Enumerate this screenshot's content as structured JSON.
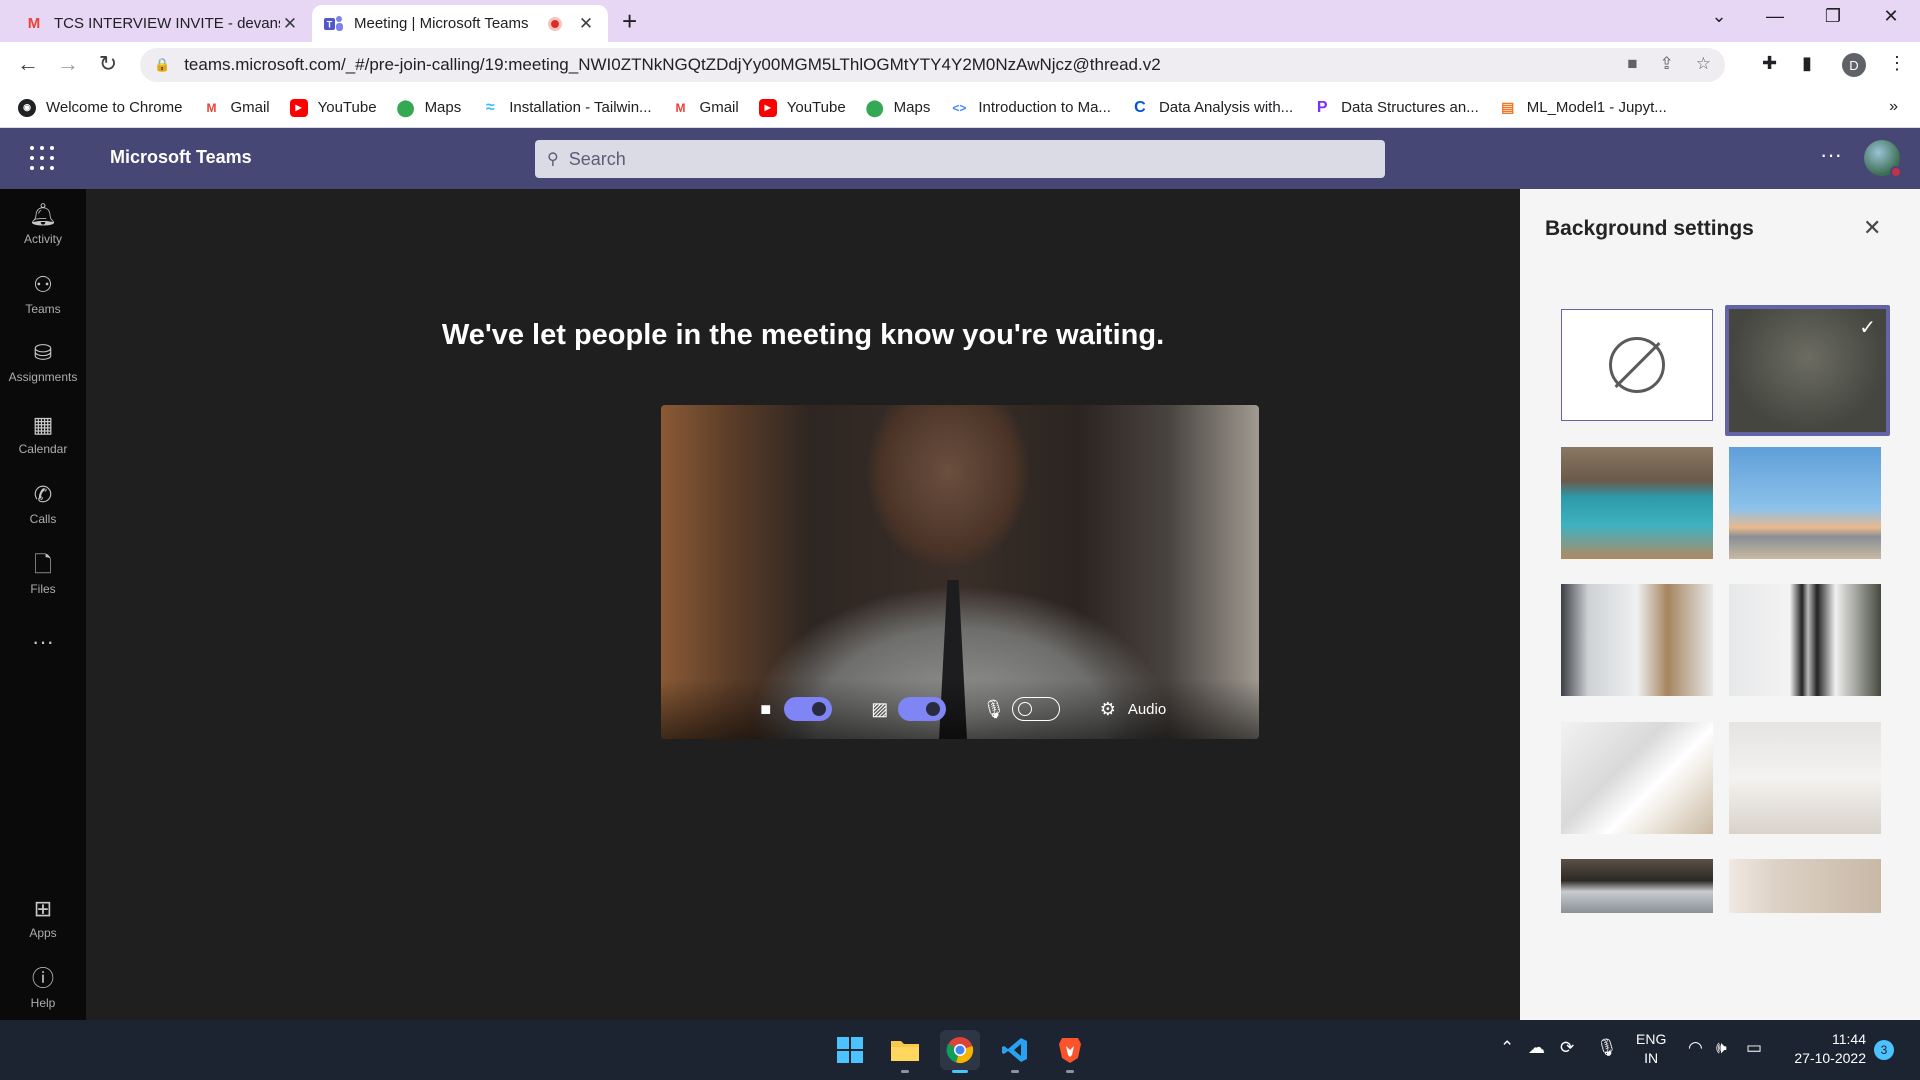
{
  "browser": {
    "tabs": [
      {
        "title": "TCS INTERVIEW INVITE - devansh",
        "favicon": "gmail-icon"
      },
      {
        "title": "Meeting | Microsoft Teams",
        "favicon": "teams-icon",
        "recording": true
      }
    ],
    "url": "teams.microsoft.com/_#/pre-join-calling/19:meeting_NWI0ZTNkNGQtZDdjYy00MGM5LThlOGMtYTY4Y2M0NzAwNjcz@thread.v2",
    "profile_initial": "D",
    "bookmarks": [
      {
        "label": "Welcome to Chrome",
        "icon": "chrome-icon"
      },
      {
        "label": "Gmail",
        "icon": "gmail-icon"
      },
      {
        "label": "YouTube",
        "icon": "youtube-icon"
      },
      {
        "label": "Maps",
        "icon": "maps-icon"
      },
      {
        "label": "Installation - Tailwin...",
        "icon": "tailwind-icon"
      },
      {
        "label": "Gmail",
        "icon": "gmail-icon"
      },
      {
        "label": "YouTube",
        "icon": "youtube-icon"
      },
      {
        "label": "Maps",
        "icon": "maps-icon"
      },
      {
        "label": "Introduction to Ma...",
        "icon": "code-icon"
      },
      {
        "label": "Data Analysis with...",
        "icon": "coursera-icon"
      },
      {
        "label": "Data Structures an...",
        "icon": "p-icon"
      },
      {
        "label": "ML_Model1 - Jupyt...",
        "icon": "jupyter-icon"
      }
    ],
    "bookmarks_more": "»"
  },
  "teams": {
    "app_title": "Microsoft Teams",
    "search_placeholder": "Search",
    "more_label": "···",
    "rail": [
      {
        "label": "Activity",
        "icon": "bell-icon"
      },
      {
        "label": "Teams",
        "icon": "teams-people-icon"
      },
      {
        "label": "Assignments",
        "icon": "backpack-icon"
      },
      {
        "label": "Calendar",
        "icon": "calendar-icon"
      },
      {
        "label": "Calls",
        "icon": "phone-icon"
      },
      {
        "label": "Files",
        "icon": "file-icon"
      }
    ],
    "rail_more": "···",
    "rail_bottom": [
      {
        "label": "Apps",
        "icon": "apps-icon"
      },
      {
        "label": "Help",
        "icon": "help-icon"
      }
    ],
    "waiting_message": "We've let people in the meeting know you're waiting.",
    "controls": {
      "camera_on": true,
      "background_effects_on": true,
      "mic_on": false,
      "audio_label": "Audio"
    },
    "background_panel": {
      "title": "Background settings",
      "options": [
        {
          "name": "none",
          "selected": false
        },
        {
          "name": "blur",
          "selected": true
        },
        {
          "name": "office-lockers",
          "selected": false
        },
        {
          "name": "beach-lifeguard",
          "selected": false
        },
        {
          "name": "white-room-window",
          "selected": false
        },
        {
          "name": "white-room-mirror",
          "selected": false
        },
        {
          "name": "white-loft-stairs",
          "selected": false
        },
        {
          "name": "white-empty-studio",
          "selected": false
        },
        {
          "name": "industrial-loft",
          "selected": false
        },
        {
          "name": "beige-wall",
          "selected": false
        }
      ]
    }
  },
  "taskbar": {
    "language": "ENG",
    "region": "IN",
    "time": "11:44",
    "date": "27-10-2022",
    "notifications": "3"
  }
}
